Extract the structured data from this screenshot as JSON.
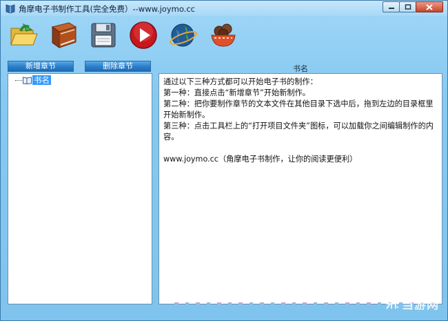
{
  "window": {
    "title": "角摩电子书制作工具(完全免费）--www.joymo.cc",
    "buttons": [
      "minimize",
      "maximize",
      "close"
    ]
  },
  "toolbar": {
    "items": [
      {
        "icon": "open-folder-icon"
      },
      {
        "icon": "book-icon"
      },
      {
        "icon": "save-disk-icon"
      },
      {
        "icon": "play-icon"
      },
      {
        "icon": "globe-icon"
      },
      {
        "icon": "coffee-bowl-icon"
      }
    ]
  },
  "left_panel": {
    "add_chapter_label": "新增章节",
    "delete_chapter_label": "删除章节",
    "tree": {
      "root_label": "书名"
    }
  },
  "content_panel": {
    "title": "书名",
    "lines": [
      "通过以下三种方式都可以开始电子书的制作：",
      "第一种：直接点击“新增章节”开始新制作。",
      "第二种：把你要制作章节的文本文件在其他目录下选中后，拖到左边的目录框里开始新制作。",
      "第三种：点击工具栏上的“打开项目文件夹”图标，可以加载你之间编辑制作的内容。",
      "",
      "www.joymo.cc（角摩电子书制作，让你的阅读更便利）"
    ]
  },
  "watermark": {
    "text": "当游网"
  },
  "colors": {
    "window_bg": "#86c9f1",
    "button_blue": "#2a7dc8",
    "selection": "#3399ff"
  }
}
